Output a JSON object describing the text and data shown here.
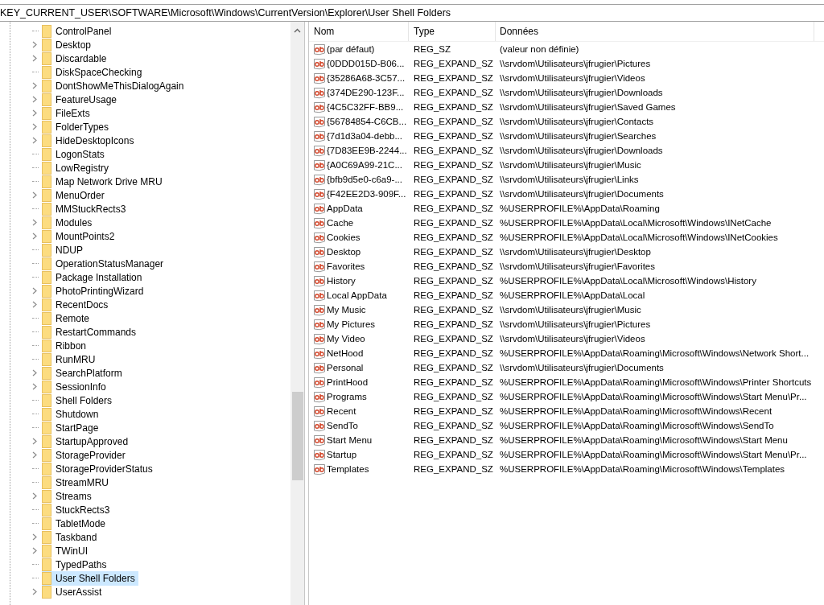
{
  "address_bar": {
    "path": "KEY_CURRENT_USER\\SOFTWARE\\Microsoft\\Windows\\CurrentVersion\\Explorer\\User Shell Folders"
  },
  "tree": {
    "items": [
      {
        "label": "ControlPanel",
        "has_children": false,
        "selected": false
      },
      {
        "label": "Desktop",
        "has_children": true,
        "selected": false
      },
      {
        "label": "Discardable",
        "has_children": true,
        "selected": false
      },
      {
        "label": "DiskSpaceChecking",
        "has_children": false,
        "selected": false
      },
      {
        "label": "DontShowMeThisDialogAgain",
        "has_children": true,
        "selected": false
      },
      {
        "label": "FeatureUsage",
        "has_children": true,
        "selected": false
      },
      {
        "label": "FileExts",
        "has_children": true,
        "selected": false
      },
      {
        "label": "FolderTypes",
        "has_children": true,
        "selected": false
      },
      {
        "label": "HideDesktopIcons",
        "has_children": true,
        "selected": false
      },
      {
        "label": "LogonStats",
        "has_children": false,
        "selected": false
      },
      {
        "label": "LowRegistry",
        "has_children": false,
        "selected": false
      },
      {
        "label": "Map Network Drive MRU",
        "has_children": false,
        "selected": false
      },
      {
        "label": "MenuOrder",
        "has_children": true,
        "selected": false
      },
      {
        "label": "MMStuckRects3",
        "has_children": false,
        "selected": false
      },
      {
        "label": "Modules",
        "has_children": true,
        "selected": false
      },
      {
        "label": "MountPoints2",
        "has_children": true,
        "selected": false
      },
      {
        "label": "NDUP",
        "has_children": false,
        "selected": false
      },
      {
        "label": "OperationStatusManager",
        "has_children": false,
        "selected": false
      },
      {
        "label": "Package Installation",
        "has_children": false,
        "selected": false
      },
      {
        "label": "PhotoPrintingWizard",
        "has_children": true,
        "selected": false
      },
      {
        "label": "RecentDocs",
        "has_children": true,
        "selected": false
      },
      {
        "label": "Remote",
        "has_children": false,
        "selected": false
      },
      {
        "label": "RestartCommands",
        "has_children": false,
        "selected": false
      },
      {
        "label": "Ribbon",
        "has_children": false,
        "selected": false
      },
      {
        "label": "RunMRU",
        "has_children": false,
        "selected": false
      },
      {
        "label": "SearchPlatform",
        "has_children": true,
        "selected": false
      },
      {
        "label": "SessionInfo",
        "has_children": true,
        "selected": false
      },
      {
        "label": "Shell Folders",
        "has_children": false,
        "selected": false
      },
      {
        "label": "Shutdown",
        "has_children": false,
        "selected": false
      },
      {
        "label": "StartPage",
        "has_children": false,
        "selected": false
      },
      {
        "label": "StartupApproved",
        "has_children": true,
        "selected": false
      },
      {
        "label": "StorageProvider",
        "has_children": true,
        "selected": false
      },
      {
        "label": "StorageProviderStatus",
        "has_children": false,
        "selected": false
      },
      {
        "label": "StreamMRU",
        "has_children": false,
        "selected": false
      },
      {
        "label": "Streams",
        "has_children": true,
        "selected": false
      },
      {
        "label": "StuckRects3",
        "has_children": false,
        "selected": false
      },
      {
        "label": "TabletMode",
        "has_children": false,
        "selected": false
      },
      {
        "label": "Taskband",
        "has_children": true,
        "selected": false
      },
      {
        "label": "TWinUI",
        "has_children": true,
        "selected": false
      },
      {
        "label": "TypedPaths",
        "has_children": false,
        "selected": false
      },
      {
        "label": "User Shell Folders",
        "has_children": false,
        "selected": true
      },
      {
        "label": "UserAssist",
        "has_children": true,
        "selected": false
      }
    ]
  },
  "values": {
    "columns": [
      "Nom",
      "Type",
      "Données"
    ],
    "rows": [
      {
        "name": "(par défaut)",
        "type": "REG_SZ",
        "data": "(valeur non définie)"
      },
      {
        "name": "{0DDD015D-B06...",
        "type": "REG_EXPAND_SZ",
        "data": "\\\\srvdom\\Utilisateurs\\jfrugier\\Pictures"
      },
      {
        "name": "{35286A68-3C57...",
        "type": "REG_EXPAND_SZ",
        "data": "\\\\srvdom\\Utilisateurs\\jfrugier\\Videos"
      },
      {
        "name": "{374DE290-123F...",
        "type": "REG_EXPAND_SZ",
        "data": "\\\\srvdom\\Utilisateurs\\jfrugier\\Downloads"
      },
      {
        "name": "{4C5C32FF-BB9...",
        "type": "REG_EXPAND_SZ",
        "data": "\\\\srvdom\\Utilisateurs\\jfrugier\\Saved Games"
      },
      {
        "name": "{56784854-C6CB...",
        "type": "REG_EXPAND_SZ",
        "data": "\\\\srvdom\\Utilisateurs\\jfrugier\\Contacts"
      },
      {
        "name": "{7d1d3a04-debb...",
        "type": "REG_EXPAND_SZ",
        "data": "\\\\srvdom\\Utilisateurs\\jfrugier\\Searches"
      },
      {
        "name": "{7D83EE9B-2244...",
        "type": "REG_EXPAND_SZ",
        "data": "\\\\srvdom\\Utilisateurs\\jfrugier\\Downloads"
      },
      {
        "name": "{A0C69A99-21C...",
        "type": "REG_EXPAND_SZ",
        "data": "\\\\srvdom\\Utilisateurs\\jfrugier\\Music"
      },
      {
        "name": "{bfb9d5e0-c6a9-...",
        "type": "REG_EXPAND_SZ",
        "data": "\\\\srvdom\\Utilisateurs\\jfrugier\\Links"
      },
      {
        "name": "{F42EE2D3-909F...",
        "type": "REG_EXPAND_SZ",
        "data": "\\\\srvdom\\Utilisateurs\\jfrugier\\Documents"
      },
      {
        "name": "AppData",
        "type": "REG_EXPAND_SZ",
        "data": "%USERPROFILE%\\AppData\\Roaming"
      },
      {
        "name": "Cache",
        "type": "REG_EXPAND_SZ",
        "data": "%USERPROFILE%\\AppData\\Local\\Microsoft\\Windows\\INetCache"
      },
      {
        "name": "Cookies",
        "type": "REG_EXPAND_SZ",
        "data": "%USERPROFILE%\\AppData\\Local\\Microsoft\\Windows\\INetCookies"
      },
      {
        "name": "Desktop",
        "type": "REG_EXPAND_SZ",
        "data": "\\\\srvdom\\Utilisateurs\\jfrugier\\Desktop"
      },
      {
        "name": "Favorites",
        "type": "REG_EXPAND_SZ",
        "data": "\\\\srvdom\\Utilisateurs\\jfrugier\\Favorites"
      },
      {
        "name": "History",
        "type": "REG_EXPAND_SZ",
        "data": "%USERPROFILE%\\AppData\\Local\\Microsoft\\Windows\\History"
      },
      {
        "name": "Local AppData",
        "type": "REG_EXPAND_SZ",
        "data": "%USERPROFILE%\\AppData\\Local"
      },
      {
        "name": "My Music",
        "type": "REG_EXPAND_SZ",
        "data": "\\\\srvdom\\Utilisateurs\\jfrugier\\Music"
      },
      {
        "name": "My Pictures",
        "type": "REG_EXPAND_SZ",
        "data": "\\\\srvdom\\Utilisateurs\\jfrugier\\Pictures"
      },
      {
        "name": "My Video",
        "type": "REG_EXPAND_SZ",
        "data": "\\\\srvdom\\Utilisateurs\\jfrugier\\Videos"
      },
      {
        "name": "NetHood",
        "type": "REG_EXPAND_SZ",
        "data": "%USERPROFILE%\\AppData\\Roaming\\Microsoft\\Windows\\Network Short..."
      },
      {
        "name": "Personal",
        "type": "REG_EXPAND_SZ",
        "data": "\\\\srvdom\\Utilisateurs\\jfrugier\\Documents"
      },
      {
        "name": "PrintHood",
        "type": "REG_EXPAND_SZ",
        "data": "%USERPROFILE%\\AppData\\Roaming\\Microsoft\\Windows\\Printer Shortcuts"
      },
      {
        "name": "Programs",
        "type": "REG_EXPAND_SZ",
        "data": "%USERPROFILE%\\AppData\\Roaming\\Microsoft\\Windows\\Start Menu\\Pr..."
      },
      {
        "name": "Recent",
        "type": "REG_EXPAND_SZ",
        "data": "%USERPROFILE%\\AppData\\Roaming\\Microsoft\\Windows\\Recent"
      },
      {
        "name": "SendTo",
        "type": "REG_EXPAND_SZ",
        "data": "%USERPROFILE%\\AppData\\Roaming\\Microsoft\\Windows\\SendTo"
      },
      {
        "name": "Start Menu",
        "type": "REG_EXPAND_SZ",
        "data": "%USERPROFILE%\\AppData\\Roaming\\Microsoft\\Windows\\Start Menu"
      },
      {
        "name": "Startup",
        "type": "REG_EXPAND_SZ",
        "data": "%USERPROFILE%\\AppData\\Roaming\\Microsoft\\Windows\\Start Menu\\Pr..."
      },
      {
        "name": "Templates",
        "type": "REG_EXPAND_SZ",
        "data": "%USERPROFILE%\\AppData\\Roaming\\Microsoft\\Windows\\Templates"
      }
    ]
  }
}
